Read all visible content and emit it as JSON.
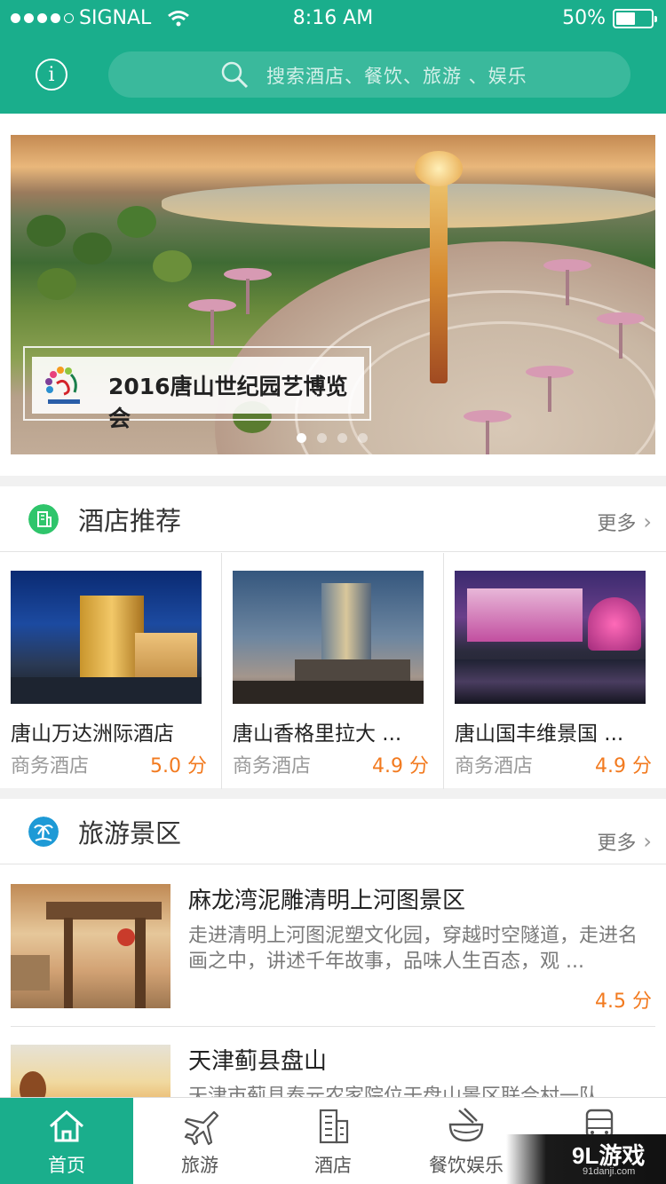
{
  "status_bar": {
    "carrier": "SIGNAL",
    "time": "8:16 AM",
    "battery": "50%"
  },
  "header": {
    "search_placeholder": "搜索酒店、餐饮、旅游 、娱乐"
  },
  "banner": {
    "caption": "2016唐山世纪园艺博览会",
    "slides": 4,
    "active_slide": 1
  },
  "hotel_section": {
    "title": "酒店推荐",
    "more": "更多",
    "items": [
      {
        "name": "唐山万达洲际酒店",
        "type": "商务酒店",
        "score": "5.0 分"
      },
      {
        "name": "唐山香格里拉大 ...",
        "type": "商务酒店",
        "score": "4.9 分"
      },
      {
        "name": "唐山国丰维景国 ...",
        "type": "商务酒店",
        "score": "4.9 分"
      }
    ]
  },
  "tour_section": {
    "title": "旅游景区",
    "more": "更多",
    "items": [
      {
        "title": "麻龙湾泥雕清明上河图景区",
        "desc": "走进清明上河图泥塑文化园，穿越时空隧道，走进名画之中，讲述千年故事，品味人生百态，观 ...",
        "score": "4.5 分"
      },
      {
        "title": "天津蓟县盘山",
        "desc": "天津市蓟县泰元农家院位于盘山景区联合村一队",
        "score": ""
      }
    ]
  },
  "tabbar": {
    "items": [
      {
        "label": "首页",
        "icon": "home-icon"
      },
      {
        "label": "旅游",
        "icon": "plane-icon"
      },
      {
        "label": "酒店",
        "icon": "building-icon"
      },
      {
        "label": "餐饮娱乐",
        "icon": "bowl-icon"
      },
      {
        "label": "",
        "icon": "bus-icon"
      }
    ]
  },
  "watermark": {
    "brand": "9L游戏",
    "url": "91danji.com"
  },
  "colors": {
    "primary": "#1aae8c",
    "score": "#f27a1f"
  }
}
